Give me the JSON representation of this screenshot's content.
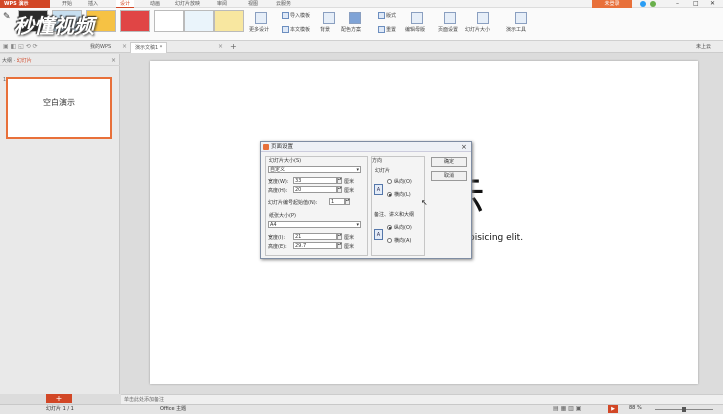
{
  "titlebar": {
    "app_menu": "WPS 演示",
    "tabs": [
      "开始",
      "插入",
      "设计",
      "动画",
      "幻灯片放映",
      "审阅",
      "视图",
      "云服务"
    ],
    "unregistered": "未登录"
  },
  "watermark": "秒懂视频",
  "ribbon": {
    "more_designs": "更多设计",
    "import_template": "导入模板",
    "this_template": "本文模板",
    "background": "背景",
    "color_scheme": "配色方案",
    "fonts": "版式",
    "reset": "重置",
    "edit_master": "编辑母版",
    "page_setup": "页面设置",
    "slide_size": "幻灯片大小",
    "presentation_tools": "演示工具"
  },
  "doc_tabs": {
    "wps": "我的WPS",
    "doc": "演示文稿1 *"
  },
  "cloud": "未上云",
  "left_pane": {
    "tab_outline": "大纲",
    "tab_slides": "幻灯片",
    "thumb_number": "1",
    "thumb_title": "空白演示"
  },
  "slide": {
    "title_visible": "示",
    "body_visible": "ur adipisicing elit."
  },
  "notes_placeholder": "单击此处添加备注",
  "status": {
    "slide_count": "幻灯片 1 / 1",
    "theme": "Office 主题",
    "zoom": "88 %"
  },
  "dialog": {
    "title": "页面设置",
    "slide_size_label": "幻灯片大小(S)",
    "slide_size_value": "自定义",
    "width_label": "宽度(W):",
    "width_value": "33",
    "height_label": "高度(H):",
    "height_value": "20",
    "unit": "厘米",
    "start_num_label": "幻灯片编号起始值(N):",
    "start_num_value": "1",
    "paper_label": "纸张大小(P)",
    "paper_value": "A4",
    "paper_width_label": "宽度(I):",
    "paper_width_value": "21",
    "paper_height_label": "高度(E):",
    "paper_height_value": "29.7",
    "orientation": "方向",
    "slides_orient": "幻灯片",
    "portrait_1": "纵向(O)",
    "landscape_1": "横向(L)",
    "notes_orient": "备注、讲义和大纲",
    "portrait_2": "纵向(O)",
    "landscape_2": "横向(A)",
    "ok": "确定",
    "cancel": "取消"
  }
}
